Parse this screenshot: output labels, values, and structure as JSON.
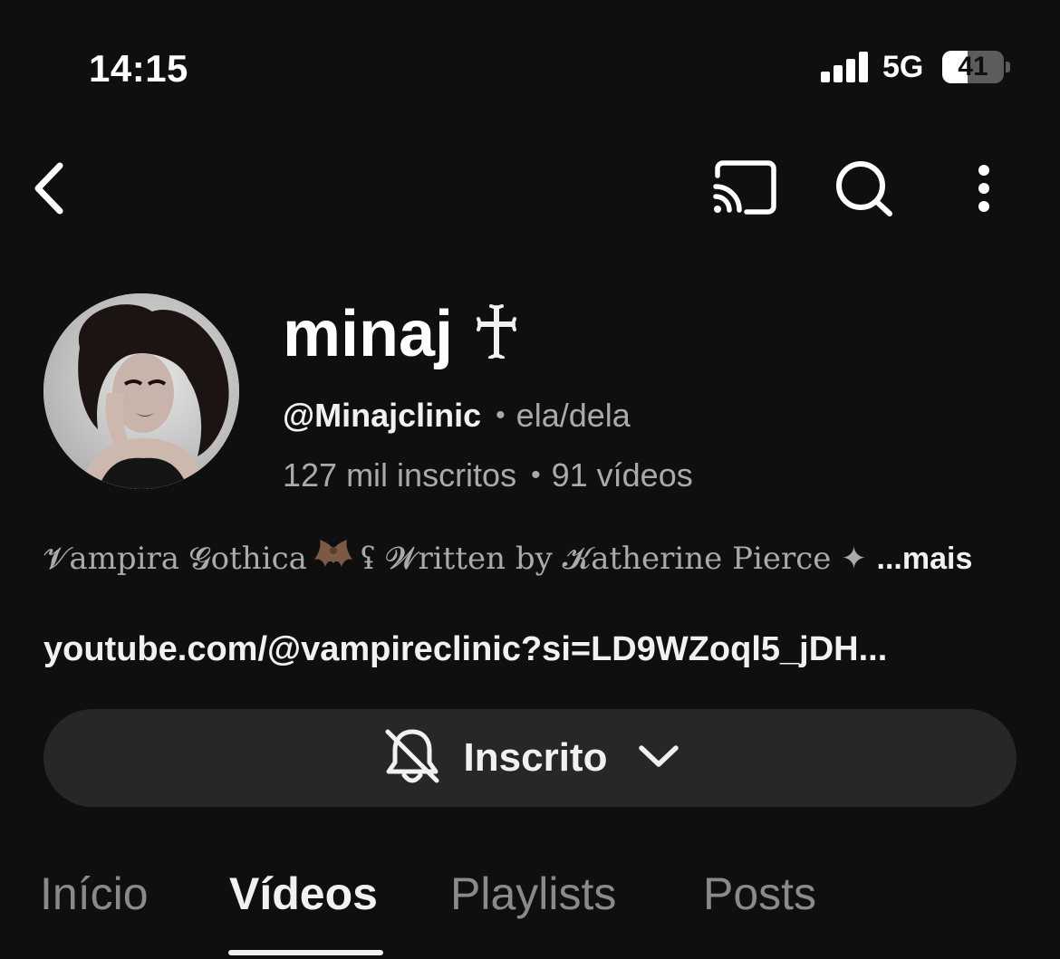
{
  "status_bar": {
    "time": "14:15",
    "network": "5G",
    "battery": "41",
    "battery_level": 0.41
  },
  "toolbar": {
    "back_icon": "chevron-left-icon",
    "cast_icon": "cast-icon",
    "search_icon": "search-icon",
    "more_icon": "more-vertical-icon"
  },
  "channel": {
    "name": "minaj",
    "handle": "@Minajclinic",
    "pronouns": "ela/dela",
    "subscribers": "127 mil inscritos",
    "videos": "91 vídeos",
    "separator": "•",
    "description_part1": "𝓥ampira 𝓖othica",
    "description_part2": "ʢ 𝓦ritten by 𝓚atherine Pierce",
    "description_star": "✦",
    "description_more": "...mais",
    "link": "youtube.com/@vampireclinic?si=LD9WZoql5_jDH..."
  },
  "subscribe": {
    "label": "Inscrito",
    "icon": "bell-off-icon",
    "chevron": "chevron-down-icon"
  },
  "tabs": [
    {
      "label": "Início",
      "active": false
    },
    {
      "label": "Vídeos",
      "active": true
    },
    {
      "label": "Playlists",
      "active": false
    },
    {
      "label": "Posts",
      "active": false
    }
  ],
  "colors": {
    "background": "#0f0f0f",
    "button": "#272727",
    "text_primary": "#f1f1f1",
    "text_secondary": "#aaaaaa"
  }
}
